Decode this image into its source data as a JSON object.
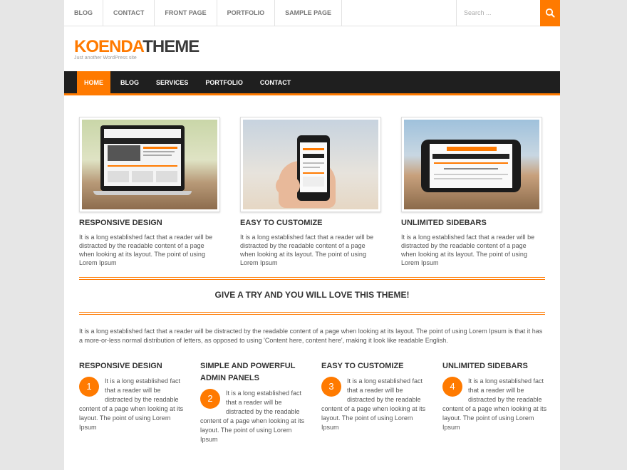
{
  "topnav": {
    "items": [
      "Blog",
      "Contact",
      "Front Page",
      "Portfolio",
      "Sample Page"
    ]
  },
  "search": {
    "placeholder": "Search ..."
  },
  "logo": {
    "part1": "KOENDA",
    "part2": "THEME",
    "tagline": "Just another WordPress site"
  },
  "mainnav": {
    "items": [
      "Home",
      "Blog",
      "Services",
      "Portfolio",
      "Contact"
    ],
    "active": "Home"
  },
  "features": [
    {
      "title": "Responsive Design",
      "text": "It is a long established fact that a reader will be distracted by the readable content of a page when looking at its layout. The point of using Lorem Ipsum"
    },
    {
      "title": "Easy to Customize",
      "text": "It is a long established fact that a reader will be distracted by the readable content of a page when looking at its layout. The point of using Lorem Ipsum"
    },
    {
      "title": "Unlimited Sidebars",
      "text": "It is a long established fact that a reader will be distracted by the readable content of a page when looking at its layout. The point of using Lorem Ipsum"
    }
  ],
  "banner": {
    "title": "Give a try and you will love this theme!"
  },
  "intro": "It is a long established fact that a reader will be distracted by the readable content of a page when looking at its layout. The point of using Lorem Ipsum is that it has a more-or-less normal distribution of letters, as opposed to using 'Content here, content here', making it look like readable English.",
  "columns": [
    {
      "number": "1",
      "title": "Responsive Design",
      "text": "It is a long established fact that a reader will be distracted by the readable content of a page when looking at its layout. The point of using Lorem Ipsum"
    },
    {
      "number": "2",
      "title": "Simple and Powerful Admin Panels",
      "text": "It is a long established fact that a reader will be distracted by the readable content of a page when looking at its layout. The point of using Lorem Ipsum"
    },
    {
      "number": "3",
      "title": "Easy to Customize",
      "text": "It is a long established fact that a reader will be distracted by the readable content of a page when looking at its layout. The point of using Lorem Ipsum"
    },
    {
      "number": "4",
      "title": "Unlimited Sidebars",
      "text": "It is a long established fact that a reader will be distracted by the readable content of a page when looking at its layout. The point of using Lorem Ipsum"
    }
  ],
  "colors": {
    "accent": "#ff7a00",
    "nav_bg": "#1f1f1f",
    "page_bg": "#e6e6e6"
  },
  "icons": {
    "search": "search-icon"
  }
}
